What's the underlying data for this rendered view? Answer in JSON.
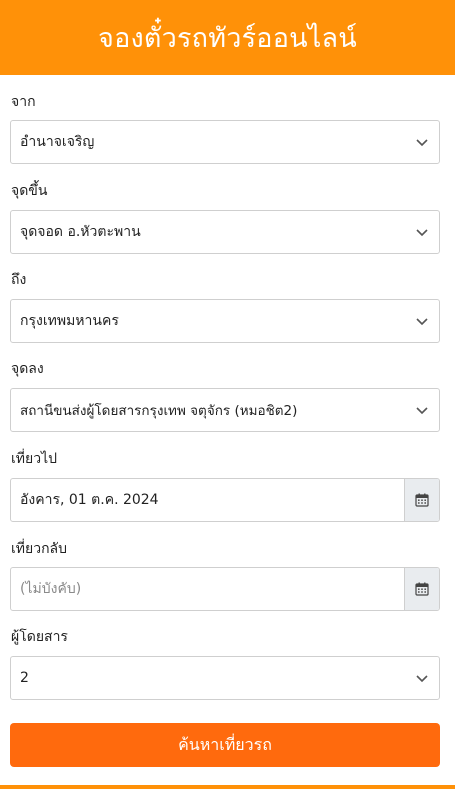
{
  "header": {
    "title": "จองตั๋วรถทัวร์ออนไลน์"
  },
  "form": {
    "origin": {
      "label": "จาก",
      "value": "อำนาจเจริญ"
    },
    "pickup": {
      "label": "จุดขึ้น",
      "value": "จุดจอด อ.หัวตะพาน"
    },
    "destination": {
      "label": "ถึง",
      "value": "กรุงเทพมหานคร"
    },
    "dropoff": {
      "label": "จุดลง",
      "value": "สถานีขนส่งผู้โดยสารกรุงเทพ จตุจักร (หมอชิต2)"
    },
    "depart": {
      "label": "เที่ยวไป",
      "value": "อังคาร, 01 ต.ค. 2024"
    },
    "return": {
      "label": "เที่ยวกลับ",
      "placeholder": "(ไม่บังคับ)"
    },
    "passengers": {
      "label": "ผู้โดยสาร",
      "value": "2"
    },
    "search_label": "ค้นหาเที่ยวรถ"
  },
  "colors": {
    "header": "#ff9108",
    "button": "#ff6a0d"
  }
}
